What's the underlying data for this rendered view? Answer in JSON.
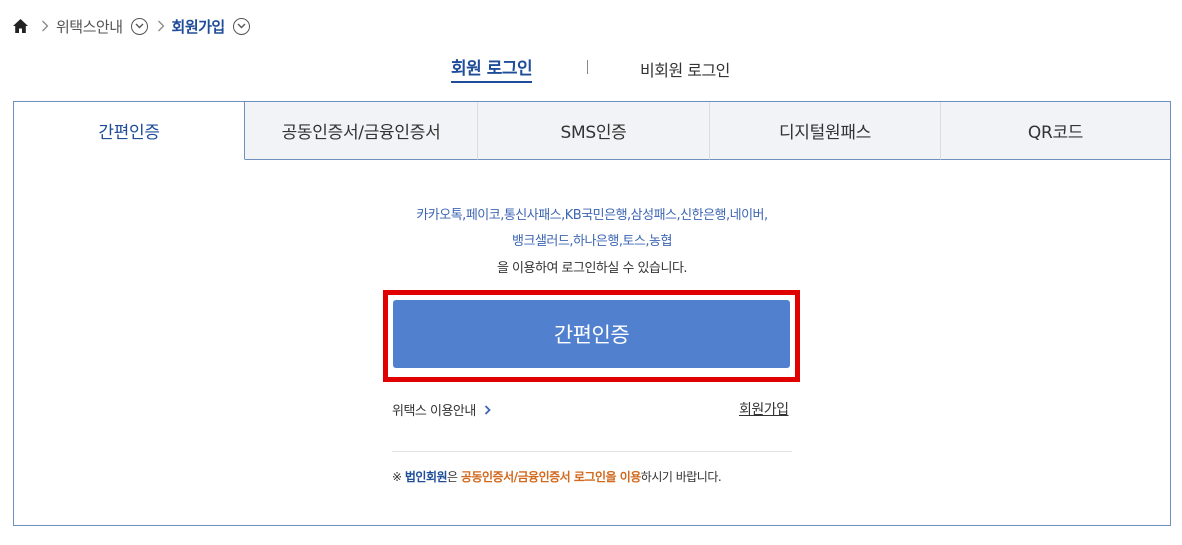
{
  "breadcrumb": {
    "items": [
      "위택스안내",
      "회원가입"
    ]
  },
  "login_switch": {
    "member": "회원 로그인",
    "divider": "|",
    "nonmember": "비회원 로그인"
  },
  "tabs": [
    {
      "label": "간편인증",
      "active": true
    },
    {
      "label": "공동인증서/금융인증서",
      "active": false
    },
    {
      "label": "SMS인증",
      "active": false
    },
    {
      "label": "디지털원패스",
      "active": false
    },
    {
      "label": "QR코드",
      "active": false
    }
  ],
  "simple_auth": {
    "providers_line1": "카카오톡,페이코,통신사패스,KB국민은행,삼성패스,신한은행,네이버,",
    "providers_line2": "뱅크샐러드,하나은행,토스,농협",
    "desc_line3": "을 이용하여 로그인하실 수 있습니다.",
    "button_label": "간편인증",
    "guide_link": "위택스 이용안내",
    "signup_link": "회원가입"
  },
  "notice": {
    "mark": "※ ",
    "part1": "법인회원",
    "part2": "은 ",
    "part3": "공동인증서/금융인증서 로그인을 이용",
    "part4": "하시기 바랍니다."
  },
  "colors": {
    "brand_blue": "#1f4d99",
    "button_blue": "#5180cf",
    "highlight_red": "#e00000",
    "notice_orange": "#d2691e"
  },
  "icons": [
    "home-icon",
    "chevron-right-icon",
    "circle-chevron-down-icon"
  ]
}
